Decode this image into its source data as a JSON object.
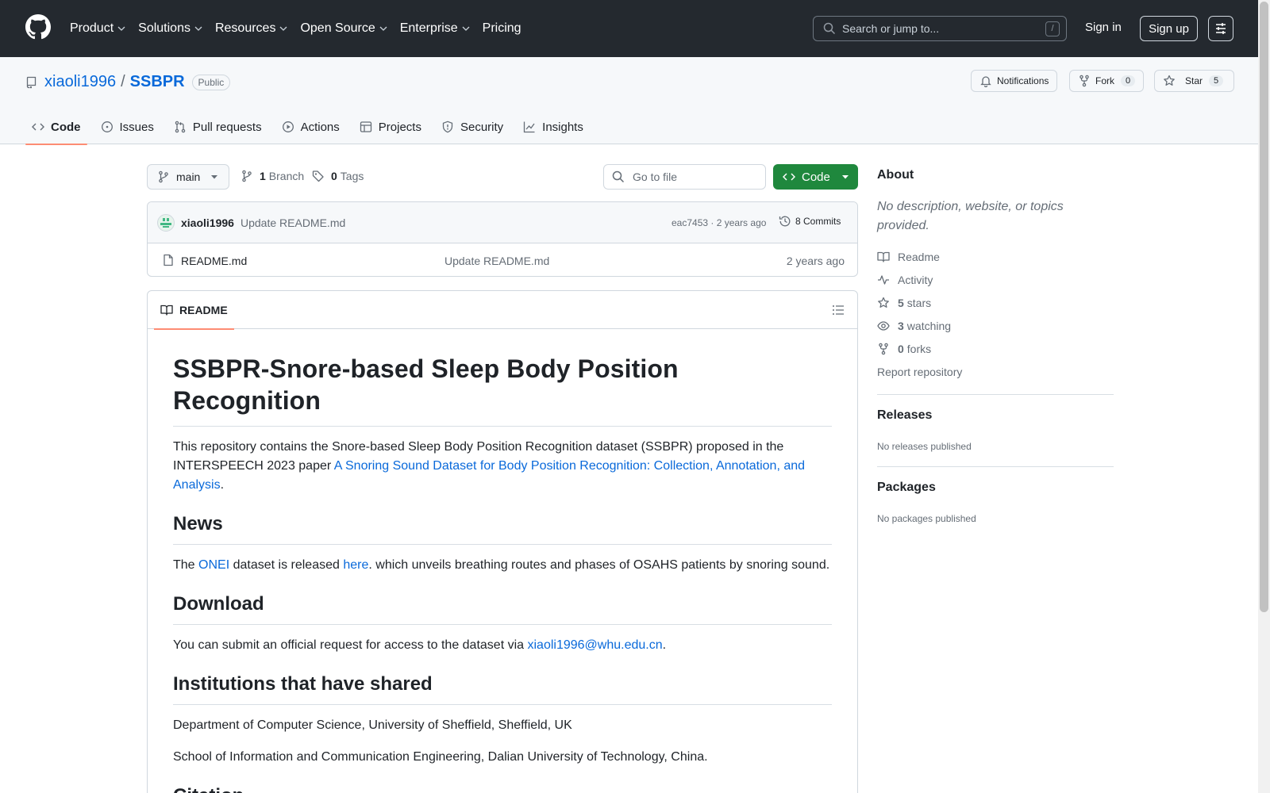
{
  "header": {
    "nav": [
      "Product",
      "Solutions",
      "Resources",
      "Open Source",
      "Enterprise",
      "Pricing"
    ],
    "search_placeholder": "Search or jump to...",
    "search_key": "/",
    "sign_in": "Sign in",
    "sign_up": "Sign up"
  },
  "repo": {
    "owner": "xiaoli1996",
    "separator": "/",
    "name": "SSBPR",
    "visibility": "Public",
    "notifications_label": "Notifications",
    "fork_label": "Fork",
    "fork_count": "0",
    "star_label": "Star",
    "star_count": "5"
  },
  "tabs": [
    "Code",
    "Issues",
    "Pull requests",
    "Actions",
    "Projects",
    "Security",
    "Insights"
  ],
  "toolbar": {
    "branch": "main",
    "branch_count": "1",
    "branch_label": "Branch",
    "tag_count": "0",
    "tag_label": "Tags",
    "go_to_file": "Go to file",
    "code_button": "Code"
  },
  "commit": {
    "author": "xiaoli1996",
    "message": "Update README.md",
    "hash_age": "eac7453 · 2 years ago",
    "commits": "8 Commits"
  },
  "files": [
    {
      "name": "README.md",
      "message": "Update README.md",
      "age": "2 years ago"
    }
  ],
  "readme": {
    "tab_label": "README",
    "title": "SSBPR-Snore-based Sleep Body Position Recognition",
    "intro_text": "This repository contains the Snore-based Sleep Body Position Recognition dataset (SSBPR) proposed in the INTERSPEECH 2023 paper ",
    "intro_link": "A Snoring Sound Dataset for Body Position Recognition: Collection, Annotation, and Analysis",
    "intro_end": ".",
    "news_heading": "News",
    "news_pre": "The ",
    "news_link1": "ONEI",
    "news_mid": " dataset is released ",
    "news_link2": "here",
    "news_post": ". which unveils breathing routes and phases of OSAHS patients by snoring sound.",
    "download_heading": "Download",
    "download_text": "You can submit an official request for access to the dataset via ",
    "download_link": "xiaoli1996@whu.edu.cn",
    "download_end": ".",
    "institutions_heading": "Institutions that have shared",
    "institution_1": "Department of Computer Science, University of Sheffield, Sheffield, UK",
    "institution_2": "School of Information and Communication Engineering, Dalian University of Technology, China.",
    "citation_heading": "Citation"
  },
  "sidebar": {
    "about_title": "About",
    "about_desc": "No description, website, or topics provided.",
    "readme": "Readme",
    "activity": "Activity",
    "stars_count": "5",
    "stars_label": "stars",
    "watching_count": "3",
    "watching_label": "watching",
    "forks_count": "0",
    "forks_label": "forks",
    "report": "Report repository",
    "releases_title": "Releases",
    "releases_text": "No releases published",
    "packages_title": "Packages",
    "packages_text": "No packages published"
  },
  "icons": {
    "logo": "github-mark-icon",
    "repo": "repo-icon",
    "bell": "bell-icon",
    "fork": "fork-icon",
    "star": "star-icon",
    "tabs": [
      "code-icon",
      "issue-icon",
      "pull-request-icon",
      "play-icon",
      "table-icon",
      "shield-icon",
      "graph-icon"
    ]
  },
  "colors": {
    "header_bg": "#24292f",
    "link": "#0969da",
    "green_button": "#1f883d",
    "active_tab_underline": "#fd8c73"
  }
}
